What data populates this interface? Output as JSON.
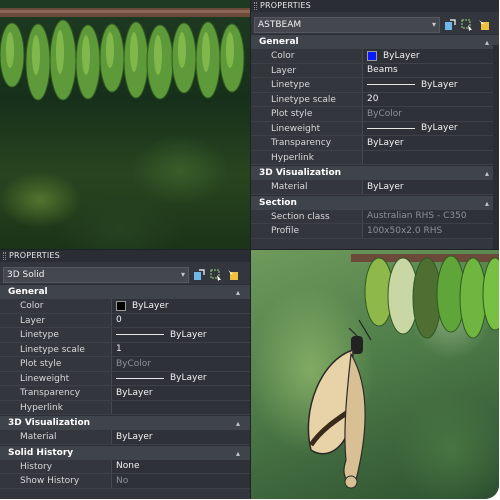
{
  "top_panel": {
    "title": "PROPERTIES",
    "selector": "ASTBEAM",
    "sections": [
      {
        "name": "General",
        "rows": [
          {
            "key": "Color",
            "value": "ByLayer",
            "kind": "color",
            "swatch": "#0a1bff"
          },
          {
            "key": "Layer",
            "value": "Beams"
          },
          {
            "key": "Linetype",
            "value": "ByLayer",
            "kind": "line"
          },
          {
            "key": "Linetype scale",
            "value": "20"
          },
          {
            "key": "Plot style",
            "value": "ByColor",
            "dim": true
          },
          {
            "key": "Lineweight",
            "value": "ByLayer",
            "kind": "line"
          },
          {
            "key": "Transparency",
            "value": "ByLayer"
          },
          {
            "key": "Hyperlink",
            "value": ""
          }
        ]
      },
      {
        "name": "3D Visualization",
        "rows": [
          {
            "key": "Material",
            "value": "ByLayer"
          }
        ]
      },
      {
        "name": "Section",
        "rows": [
          {
            "key": "Section class",
            "value": "Australian RHS - C350",
            "dim": true
          },
          {
            "key": "Profile",
            "value": "100x50x2.0 RHS",
            "dim": true
          }
        ]
      }
    ]
  },
  "bottom_panel": {
    "title": "PROPERTIES",
    "selector": "3D Solid",
    "sections": [
      {
        "name": "General",
        "rows": [
          {
            "key": "Color",
            "value": "ByLayer",
            "kind": "color",
            "swatch": "#000000"
          },
          {
            "key": "Layer",
            "value": "0"
          },
          {
            "key": "Linetype",
            "value": "ByLayer",
            "kind": "line"
          },
          {
            "key": "Linetype scale",
            "value": "1"
          },
          {
            "key": "Plot style",
            "value": "ByColor",
            "dim": true
          },
          {
            "key": "Lineweight",
            "value": "ByLayer",
            "kind": "line"
          },
          {
            "key": "Transparency",
            "value": "ByLayer"
          },
          {
            "key": "Hyperlink",
            "value": ""
          }
        ]
      },
      {
        "name": "3D Visualization",
        "rows": [
          {
            "key": "Material",
            "value": "ByLayer"
          }
        ]
      },
      {
        "name": "Solid History",
        "rows": [
          {
            "key": "History",
            "value": "None"
          },
          {
            "key": "Show History",
            "value": "No",
            "dim": true
          }
        ]
      }
    ]
  },
  "icons": [
    "quick-select-icon",
    "select-objects-icon",
    "toggle-pickadd-icon"
  ],
  "colors": {
    "panel_bg": "#33363d",
    "section_bg": "#3f434a",
    "value_bg": "#2e3137"
  }
}
